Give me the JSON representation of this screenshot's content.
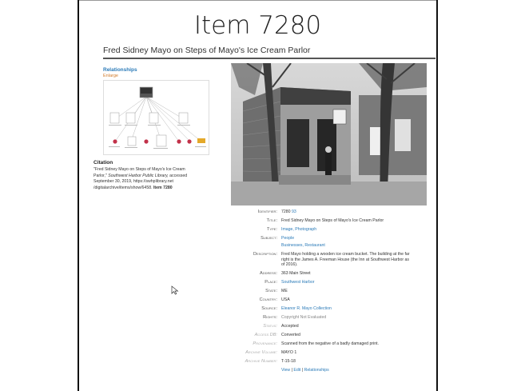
{
  "slide_title": "Item 7280",
  "page_heading": "Fred Sidney Mayo on Steps of Mayo's Ice Cream Parlor",
  "relationships": {
    "title": "Relationships",
    "enlarge": "Enlarge"
  },
  "citation": {
    "title": "Citation",
    "line1": "\"Fred Sidney Mayo on Steps of Mayo's Ice Cream",
    "line2_plain": "Parlor,\" ",
    "line2_italic": "Southwest Harbor Public Library,",
    "line2_rest": " accessed",
    "line3": "September 30, 2019, https://swhplibrary.net",
    "line4_plain": "/digitalarchive/items/show/6458. ",
    "line4_bold": "Item 7280"
  },
  "metadata": {
    "identifier_label": "Identifier:",
    "identifier_value": "7280",
    "identifier_link": "93",
    "title_label": "Title:",
    "title_value": "Fred Sidney Mayo on Steps of Mayo's Ice Cream Parlor",
    "type_label": "Type:",
    "type_value": "Image, Photograph",
    "subject_label": "Subject:",
    "subject_value1": "People",
    "subject_value2": "Businesses, Restaurant",
    "description_label": "Description:",
    "description_line1": "Fred Mayo holding a wooden ice cream bucket. The building at the far",
    "description_line2": "right is the James A. Freeman House (the Inn at Southwest Harbor as",
    "description_line3": "of 2016).",
    "address_label": "Address:",
    "address_value": "363 Main Street",
    "place_label": "Place:",
    "place_value": "Southwest Harbor",
    "state_label": "State:",
    "state_value": "ME",
    "country_label": "Country:",
    "country_value": "USA",
    "source_label": "Source:",
    "source_value": "Eleanor R. Mayo Collection",
    "rights_label": "Rights:",
    "rights_value": "Copyright Not Evaluated",
    "status_label": "Status:",
    "status_value": "Accepted",
    "access_label": "Access DB:",
    "access_value": "Converted",
    "provenance_label": "Provenance:",
    "provenance_value": "Scanned from the negative of a badly damaged print.",
    "volume_label": "Archive Volume:",
    "volume_value": "MAYO 1",
    "number_label": "Archive Number:",
    "number_value": "T-15-18"
  },
  "actions": {
    "view": "View",
    "edit": "Edit",
    "relationships": "Relationships",
    "separator": " | "
  },
  "icons": {
    "cursor": "mouse-pointer-icon"
  }
}
